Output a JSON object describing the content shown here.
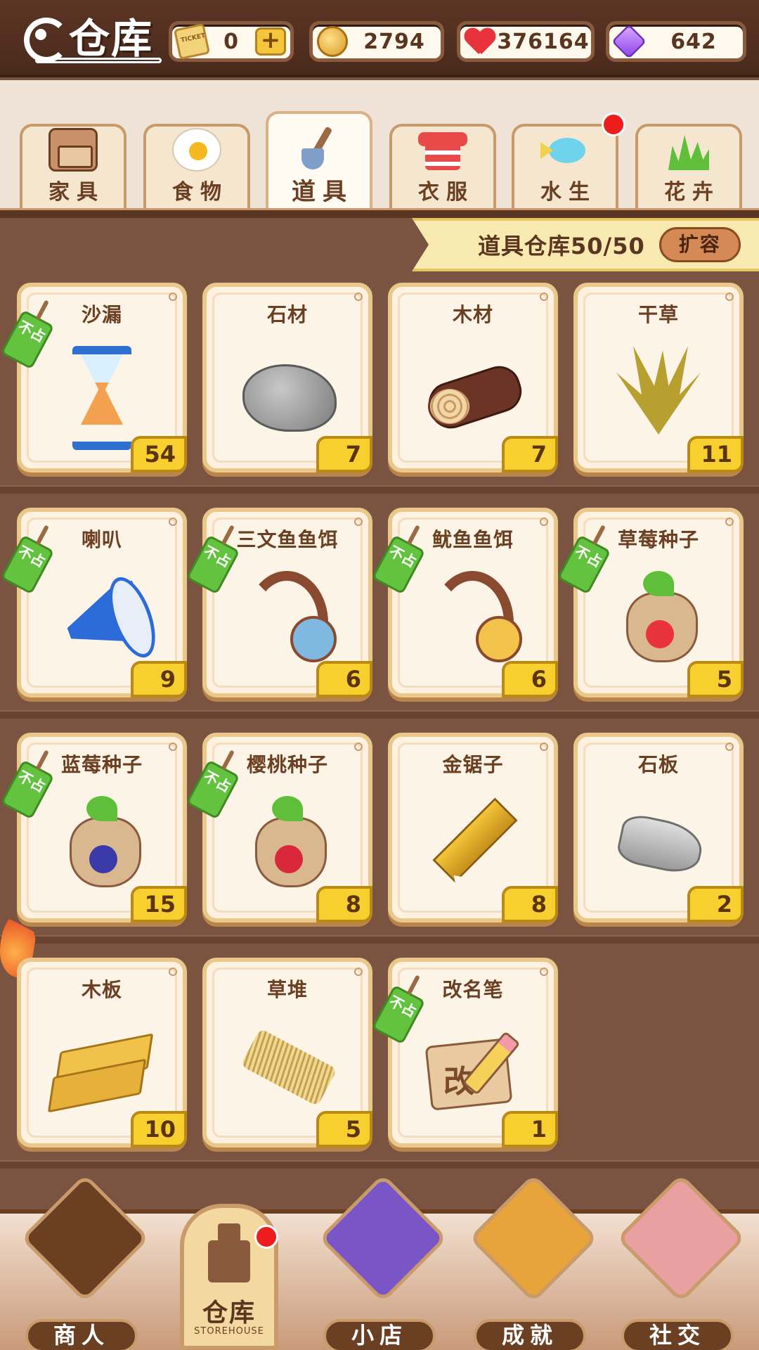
{
  "header": {
    "title": "仓库",
    "resources": [
      {
        "name": "ticket",
        "icon": "ticket-icon",
        "value": "0",
        "has_plus": true
      },
      {
        "name": "coin",
        "icon": "coin-icon",
        "value": "2794"
      },
      {
        "name": "heart",
        "icon": "heart-icon",
        "value": "376164"
      },
      {
        "name": "gem",
        "icon": "gem-icon",
        "value": "642"
      }
    ],
    "ticket_icon_text": "TICKET",
    "plus_label": "+"
  },
  "tabs": [
    {
      "label": "家具",
      "icon": "cabinet-icon",
      "active": false
    },
    {
      "label": "食物",
      "icon": "egg-icon",
      "active": false
    },
    {
      "label": "道具",
      "icon": "shovel-icon",
      "active": true
    },
    {
      "label": "衣服",
      "icon": "shirt-icon",
      "active": false
    },
    {
      "label": "水生",
      "icon": "fish-icon",
      "active": false,
      "notification": true
    },
    {
      "label": "花卉",
      "icon": "grass-icon",
      "active": false
    }
  ],
  "capacity": {
    "label": "道具仓库50/50",
    "expand_label": "扩容"
  },
  "tag_text": "不占",
  "items": [
    {
      "name": "沙漏",
      "count": "54",
      "tag": true,
      "art": "hourglass-icon"
    },
    {
      "name": "石材",
      "count": "7",
      "tag": false,
      "art": "rock-icon"
    },
    {
      "name": "木材",
      "count": "7",
      "tag": false,
      "art": "log-icon"
    },
    {
      "name": "干草",
      "count": "11",
      "tag": false,
      "art": "hay-icon"
    },
    {
      "name": "喇叭",
      "count": "9",
      "tag": true,
      "art": "megaphone-icon"
    },
    {
      "name": "三文鱼鱼饵",
      "count": "6",
      "tag": true,
      "art": "salmon-bait-icon"
    },
    {
      "name": "鱿鱼鱼饵",
      "count": "6",
      "tag": true,
      "art": "squid-bait-icon"
    },
    {
      "name": "草莓种子",
      "count": "5",
      "tag": true,
      "art": "strawberry-seed-icon"
    },
    {
      "name": "蓝莓种子",
      "count": "15",
      "tag": true,
      "art": "blueberry-seed-icon"
    },
    {
      "name": "樱桃种子",
      "count": "8",
      "tag": true,
      "art": "cherry-seed-icon"
    },
    {
      "name": "金锯子",
      "count": "8",
      "tag": false,
      "art": "saw-icon"
    },
    {
      "name": "石板",
      "count": "2",
      "tag": false,
      "art": "slate-icon"
    },
    {
      "name": "木板",
      "count": "10",
      "tag": false,
      "art": "plank-icon"
    },
    {
      "name": "草堆",
      "count": "5",
      "tag": false,
      "art": "straw-icon"
    },
    {
      "name": "改名笔",
      "count": "1",
      "tag": true,
      "art": "rename-pen-icon",
      "glyph": "改"
    }
  ],
  "bottom_nav": [
    {
      "label": "商人",
      "icon": "merchant-icon"
    },
    {
      "label": "仓库",
      "sub": "STOREHOUSE",
      "icon": "storehouse-icon",
      "active": true,
      "notification": true
    },
    {
      "label": "小店",
      "icon": "shop-icon"
    },
    {
      "label": "成就",
      "icon": "achievement-icon"
    },
    {
      "label": "社交",
      "icon": "social-icon"
    }
  ],
  "colors": {
    "background": "#7a5440",
    "card": "#fff1df",
    "count_badge": "#f7cf2e",
    "tag": "#63c23e",
    "notification": "#ee1d1d"
  }
}
